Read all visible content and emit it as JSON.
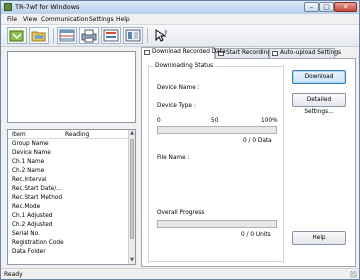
{
  "window": {
    "title": "TR-7wf for Windows"
  },
  "menu": [
    "File",
    "View",
    "Communication",
    "Settings",
    "Help"
  ],
  "toolbar": {
    "buttons": [
      {
        "icon": "download-data-icon"
      },
      {
        "icon": "open-file-icon"
      },
      {
        "icon": "data-table-icon"
      },
      {
        "icon": "print-icon"
      },
      {
        "icon": "device-list-icon"
      },
      {
        "icon": "settings-icon"
      },
      {
        "icon": "help-pointer-icon"
      }
    ]
  },
  "list": {
    "headers": {
      "item": "Item",
      "reading": "Reading"
    },
    "rows": [
      "Group Name",
      "Device Name",
      "Ch.1 Name",
      "Ch.2 Name",
      "Rec.Interval",
      "Rec.Start Date/...",
      "Rec.Start Method",
      "Rec.Mode",
      "Ch.1 Adjusted",
      "Ch.2 Adjusted",
      "Serial No.",
      "Registration Code",
      "Data Folder"
    ]
  },
  "tabs": [
    "Download Recorded Data",
    "Start Recording",
    "Auto-upload Settings"
  ],
  "download": {
    "group_title": "Downloading Status",
    "device_name_label": "Device Name :",
    "device_type_label": "Device Type :",
    "scale_min": "0",
    "scale_mid": "50",
    "scale_max": "100%",
    "data_progress": 0,
    "data_count": "0 / 0 Data",
    "file_name_label": "File Name :",
    "overall_label": "Overall Progress",
    "overall_progress": 0,
    "units_count": "0 / 0 Units",
    "download_button": "Download",
    "detailed_button": "Detailed Settings...",
    "help_button": "Help"
  },
  "status": {
    "text": "Ready"
  },
  "colors": {
    "titlebar": "#c5d9f0",
    "progress_fill": "#3fb14a",
    "accent": "#3c7fb1"
  }
}
